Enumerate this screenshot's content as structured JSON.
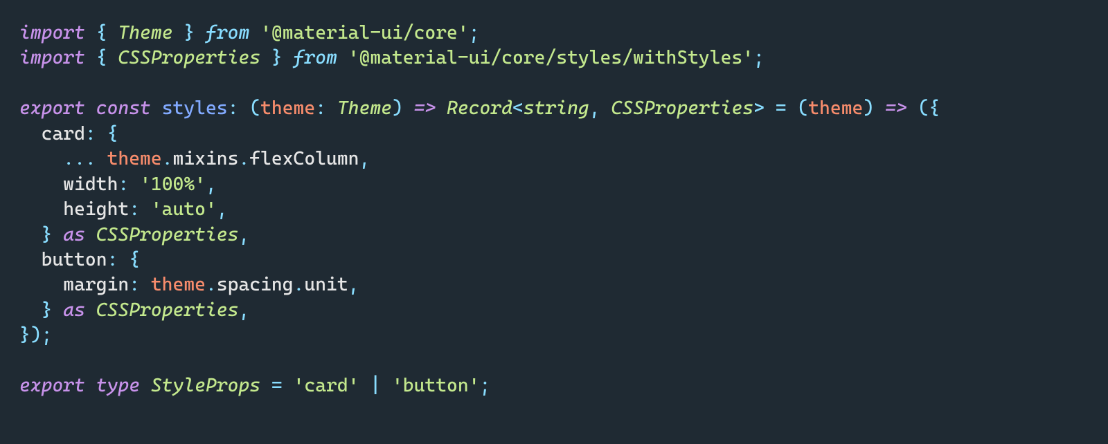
{
  "code": {
    "lines": [
      {
        "id": "l1",
        "segments": [
          [
            "kw-it",
            "import"
          ],
          [
            "prop",
            " "
          ],
          [
            "punc",
            "{"
          ],
          [
            "prop",
            " "
          ],
          [
            "type-it",
            "Theme"
          ],
          [
            "prop",
            " "
          ],
          [
            "punc",
            "}"
          ],
          [
            "prop",
            " "
          ],
          [
            "fn-it",
            "from"
          ],
          [
            "prop",
            " "
          ],
          [
            "str",
            "'@material-ui/core'"
          ],
          [
            "punc",
            ";"
          ]
        ]
      },
      {
        "id": "l2",
        "segments": [
          [
            "kw-it",
            "import"
          ],
          [
            "prop",
            " "
          ],
          [
            "punc",
            "{"
          ],
          [
            "prop",
            " "
          ],
          [
            "type-it",
            "CSSProperties"
          ],
          [
            "prop",
            " "
          ],
          [
            "punc",
            "}"
          ],
          [
            "prop",
            " "
          ],
          [
            "fn-it",
            "from"
          ],
          [
            "prop",
            " "
          ],
          [
            "str",
            "'@material-ui/core/styles/withStyles'"
          ],
          [
            "punc",
            ";"
          ]
        ]
      },
      {
        "id": "l3",
        "segments": [
          [
            "prop",
            ""
          ]
        ]
      },
      {
        "id": "l4",
        "segments": [
          [
            "kw-it",
            "export"
          ],
          [
            "prop",
            " "
          ],
          [
            "kw-it",
            "const"
          ],
          [
            "prop",
            " "
          ],
          [
            "ident",
            "styles"
          ],
          [
            "punc",
            ":"
          ],
          [
            "prop",
            " "
          ],
          [
            "punc",
            "("
          ],
          [
            "param",
            "theme"
          ],
          [
            "punc",
            ":"
          ],
          [
            "prop",
            " "
          ],
          [
            "type-it",
            "Theme"
          ],
          [
            "punc",
            ")"
          ],
          [
            "prop",
            " "
          ],
          [
            "op-it",
            "=>"
          ],
          [
            "prop",
            " "
          ],
          [
            "type-it",
            "Record"
          ],
          [
            "punc",
            "<"
          ],
          [
            "type-it",
            "string"
          ],
          [
            "punc",
            ","
          ],
          [
            "prop",
            " "
          ],
          [
            "type-it",
            "CSSProperties"
          ],
          [
            "punc",
            ">"
          ],
          [
            "prop",
            " "
          ],
          [
            "punc",
            "="
          ],
          [
            "prop",
            " "
          ],
          [
            "punc",
            "("
          ],
          [
            "param",
            "theme"
          ],
          [
            "punc",
            ")"
          ],
          [
            "prop",
            " "
          ],
          [
            "op-it",
            "=>"
          ],
          [
            "prop",
            " "
          ],
          [
            "punc",
            "("
          ],
          [
            "punc",
            "{"
          ]
        ]
      },
      {
        "id": "l5",
        "segments": [
          [
            "dim",
            "  "
          ],
          [
            "prop",
            "card"
          ],
          [
            "punc",
            ":"
          ],
          [
            "prop",
            " "
          ],
          [
            "punc",
            "{"
          ]
        ]
      },
      {
        "id": "l6",
        "segments": [
          [
            "dim",
            "  "
          ],
          [
            "dim",
            "  "
          ],
          [
            "punc",
            "..."
          ],
          [
            "prop",
            " "
          ],
          [
            "param",
            "theme"
          ],
          [
            "punc",
            "."
          ],
          [
            "member",
            "mixins"
          ],
          [
            "punc",
            "."
          ],
          [
            "member",
            "flexColumn"
          ],
          [
            "punc",
            ","
          ]
        ]
      },
      {
        "id": "l7",
        "segments": [
          [
            "dim",
            "  "
          ],
          [
            "dim",
            "  "
          ],
          [
            "prop",
            "width"
          ],
          [
            "punc",
            ":"
          ],
          [
            "prop",
            " "
          ],
          [
            "str",
            "'100%'"
          ],
          [
            "punc",
            ","
          ]
        ]
      },
      {
        "id": "l8",
        "segments": [
          [
            "dim",
            "  "
          ],
          [
            "dim",
            "  "
          ],
          [
            "prop",
            "height"
          ],
          [
            "punc",
            ":"
          ],
          [
            "prop",
            " "
          ],
          [
            "str",
            "'auto'"
          ],
          [
            "punc",
            ","
          ]
        ]
      },
      {
        "id": "l9",
        "segments": [
          [
            "dim",
            "  "
          ],
          [
            "punc",
            "}"
          ],
          [
            "prop",
            " "
          ],
          [
            "kw-it",
            "as"
          ],
          [
            "prop",
            " "
          ],
          [
            "type-it",
            "CSSProperties"
          ],
          [
            "punc",
            ","
          ]
        ]
      },
      {
        "id": "l10",
        "segments": [
          [
            "dim",
            "  "
          ],
          [
            "prop",
            "button"
          ],
          [
            "punc",
            ":"
          ],
          [
            "prop",
            " "
          ],
          [
            "punc",
            "{"
          ]
        ]
      },
      {
        "id": "l11",
        "segments": [
          [
            "dim",
            "  "
          ],
          [
            "dim",
            "  "
          ],
          [
            "prop",
            "margin"
          ],
          [
            "punc",
            ":"
          ],
          [
            "prop",
            " "
          ],
          [
            "param",
            "theme"
          ],
          [
            "punc",
            "."
          ],
          [
            "member",
            "spacing"
          ],
          [
            "punc",
            "."
          ],
          [
            "member",
            "unit"
          ],
          [
            "punc",
            ","
          ]
        ]
      },
      {
        "id": "l12",
        "segments": [
          [
            "dim",
            "  "
          ],
          [
            "punc",
            "}"
          ],
          [
            "prop",
            " "
          ],
          [
            "kw-it",
            "as"
          ],
          [
            "prop",
            " "
          ],
          [
            "type-it",
            "CSSProperties"
          ],
          [
            "punc",
            ","
          ]
        ]
      },
      {
        "id": "l13",
        "segments": [
          [
            "punc",
            "}"
          ],
          [
            "punc",
            ")"
          ],
          [
            "punc",
            ";"
          ]
        ]
      },
      {
        "id": "l14",
        "segments": [
          [
            "prop",
            ""
          ]
        ]
      },
      {
        "id": "l15",
        "segments": [
          [
            "kw-it",
            "export"
          ],
          [
            "prop",
            " "
          ],
          [
            "kw-it",
            "type"
          ],
          [
            "prop",
            " "
          ],
          [
            "type-it",
            "StyleProps"
          ],
          [
            "prop",
            " "
          ],
          [
            "punc",
            "="
          ],
          [
            "prop",
            " "
          ],
          [
            "str",
            "'card'"
          ],
          [
            "prop",
            " "
          ],
          [
            "punc",
            "|"
          ],
          [
            "prop",
            " "
          ],
          [
            "str",
            "'button'"
          ],
          [
            "punc",
            ";"
          ]
        ]
      }
    ]
  }
}
